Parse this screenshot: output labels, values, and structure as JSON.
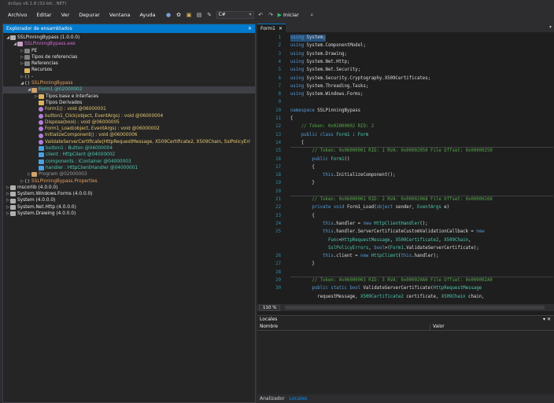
{
  "window": {
    "title": "dnSpy v6.1.8 (32-bit, .NET)"
  },
  "menu": [
    "Archivo",
    "Editar",
    "Ver",
    "Depurar",
    "Ventana",
    "Ayuda"
  ],
  "toolbar": {
    "language": "C#",
    "start_label": "Iniciar"
  },
  "explorer": {
    "title": "Explorador de ensamblados",
    "close": "✕",
    "rows": [
      {
        "indent": 0,
        "exp": "◢",
        "icon": "asm",
        "text": "SSLPinningBypass (1.0.0.0)",
        "color": "c-white"
      },
      {
        "indent": 1,
        "exp": "◢",
        "icon": "mod",
        "text": "SSLPinningBypass.exe",
        "color": "c-pink"
      },
      {
        "indent": 2,
        "exp": "▷",
        "icon": "prop",
        "text": "PE",
        "color": "c-white"
      },
      {
        "indent": 2,
        "exp": "▷",
        "icon": "prop",
        "text": "Tipos de referencias",
        "color": "c-white"
      },
      {
        "indent": 2,
        "exp": "▷",
        "icon": "prop",
        "text": "Referencias",
        "color": "c-white"
      },
      {
        "indent": 2,
        "exp": "",
        "icon": "folder",
        "text": "Recursos",
        "color": "c-white"
      },
      {
        "indent": 2,
        "exp": "▷",
        "icon": "ns",
        "text": "-",
        "color": "c-white"
      },
      {
        "indent": 2,
        "exp": "◢",
        "icon": "ns",
        "text": "SSLPinningBypass",
        "color": "c-orange"
      },
      {
        "indent": 3,
        "exp": "◢",
        "icon": "cls",
        "text": "Form1 @02000002",
        "color": "c-cyan",
        "sel": true
      },
      {
        "indent": 4,
        "exp": "▷",
        "icon": "folder",
        "text": "Tipos base e Interfaces",
        "color": "c-white"
      },
      {
        "indent": 4,
        "exp": "",
        "icon": "folder",
        "text": "Tipos Derivados",
        "color": "c-white"
      },
      {
        "indent": 4,
        "exp": "",
        "icon": "meth",
        "text": "Form1() : void @06000001",
        "color": "c-yellow"
      },
      {
        "indent": 4,
        "exp": "",
        "icon": "meth",
        "text": "button1_Click(object, EventArgs) : void @06000004",
        "color": "c-yellow"
      },
      {
        "indent": 4,
        "exp": "",
        "icon": "meth",
        "text": "Dispose(bool) : void @06000005",
        "color": "c-yellow"
      },
      {
        "indent": 4,
        "exp": "",
        "icon": "meth",
        "text": "Form1_Load(object, EventArgs) : void @06000002",
        "color": "c-yellow"
      },
      {
        "indent": 4,
        "exp": "",
        "icon": "meth",
        "text": "InitializeComponent() : void @06000006",
        "color": "c-yellow"
      },
      {
        "indent": 4,
        "exp": "",
        "icon": "meth",
        "text": "ValidateServerCertificate(HttpRequestMessage, X509Certificate2, X509Chain, SslPolicyErr",
        "color": "c-yellow"
      },
      {
        "indent": 4,
        "exp": "",
        "icon": "field",
        "text": "button1 : Button @04000004",
        "color": "c-cyan"
      },
      {
        "indent": 4,
        "exp": "",
        "icon": "field",
        "text": "client : HttpClient @04000002",
        "color": "c-cyan"
      },
      {
        "indent": 4,
        "exp": "",
        "icon": "field",
        "text": "components : IContainer @04000003",
        "color": "c-cyan"
      },
      {
        "indent": 4,
        "exp": "",
        "icon": "field",
        "text": "handler : HttpClientHandler @04000001",
        "color": "c-cyan"
      },
      {
        "indent": 3,
        "exp": "▷",
        "icon": "cls",
        "text": "Program @02000003",
        "color": "c-gray"
      },
      {
        "indent": 2,
        "exp": "▷",
        "icon": "ns",
        "text": "SSLPinningBypass.Properties",
        "color": "c-orange"
      },
      {
        "indent": 0,
        "exp": "▷",
        "icon": "asm",
        "text": "mscorlib (4.0.0.0)",
        "color": "c-white"
      },
      {
        "indent": 0,
        "exp": "▷",
        "icon": "asm",
        "text": "System.Windows.Forms (4.0.0.0)",
        "color": "c-white"
      },
      {
        "indent": 0,
        "exp": "▷",
        "icon": "asm",
        "text": "System (4.0.0.0)",
        "color": "c-white"
      },
      {
        "indent": 0,
        "exp": "▷",
        "icon": "asm",
        "text": "System.Net.Http (4.0.0.0)",
        "color": "c-white"
      },
      {
        "indent": 0,
        "exp": "▷",
        "icon": "asm",
        "text": "System.Drawing (4.0.0.0)",
        "color": "c-white"
      }
    ]
  },
  "editor": {
    "tab": "Form1",
    "tab_close": "✕",
    "lines": [
      {
        "n": "1",
        "t": "using System;"
      },
      {
        "n": "2",
        "t": "using System.ComponentModel;"
      },
      {
        "n": "3",
        "t": "using System.Drawing;"
      },
      {
        "n": "4",
        "t": "using System.Net.Http;"
      },
      {
        "n": "5",
        "t": "using System.Net.Security;"
      },
      {
        "n": "6",
        "t": "using System.Security.Cryptography.X509Certificates;"
      },
      {
        "n": "7",
        "t": "using System.Threading.Tasks;"
      },
      {
        "n": "8",
        "t": "using System.Windows.Forms;"
      },
      {
        "n": "9",
        "t": ""
      },
      {
        "n": "10",
        "t": "namespace SSLPinningBypass"
      },
      {
        "n": "11",
        "t": "{"
      },
      {
        "n": "12",
        "t": "    // Token: 0x02000002 RID: 2"
      },
      {
        "n": "13",
        "t": "    public class Form1 : Form"
      },
      {
        "n": "14",
        "t": "    {"
      },
      {
        "n": "15",
        "t": "        // Token: 0x06000001 RID: 1 RVA: 0x00002050 File Offset: 0x00000250"
      },
      {
        "n": "16",
        "t": "        public Form1()"
      },
      {
        "n": "17",
        "t": "        {"
      },
      {
        "n": "18",
        "t": "            this.InitializeComponent();"
      },
      {
        "n": "19",
        "t": "        }"
      },
      {
        "n": "20",
        "t": ""
      },
      {
        "n": "21",
        "t": "        // Token: 0x06000002 RID: 2 RVA: 0x00002068 File Offset: 0x00000268"
      },
      {
        "n": "22",
        "t": "        private void Form1_Load(object sender, EventArgs e)"
      },
      {
        "n": "23",
        "t": "        {"
      },
      {
        "n": "24",
        "t": "            this.handler = new HttpClientHandler();"
      },
      {
        "n": "25",
        "t": "            this.handler.ServerCertificateCustomValidationCallback = new"
      },
      {
        "n": "",
        "t": "              Func<HttpRequestMessage, X509Certificate2, X509Chain,"
      },
      {
        "n": "",
        "t": "              SslPolicyErrors, bool>(Form1.ValidateServerCertificate);"
      },
      {
        "n": "26",
        "t": "            this.client = new HttpClient(this.handler);"
      },
      {
        "n": "27",
        "t": "        }"
      },
      {
        "n": "28",
        "t": ""
      },
      {
        "n": "29",
        "t": "        // Token: 0x06000003 RID: 3 RVA: 0x000020A0 File Offset: 0x000002A0"
      },
      {
        "n": "30",
        "t": "        public static bool ValidateServerCertificate(HttpRequestMessage"
      },
      {
        "n": "",
        "t": "          requestMessage, X509Certificate2 certificate, X509Chain chain,"
      }
    ]
  },
  "zoom": "110 %",
  "locals": {
    "title": "Locales",
    "close": "▾ ✕",
    "col_name": "Nombre",
    "col_value": "Valor"
  },
  "bottom_tabs": [
    "Analizador",
    "Locales"
  ],
  "colors": {
    "accent": "#007acc",
    "background": "#1e1e1e"
  }
}
